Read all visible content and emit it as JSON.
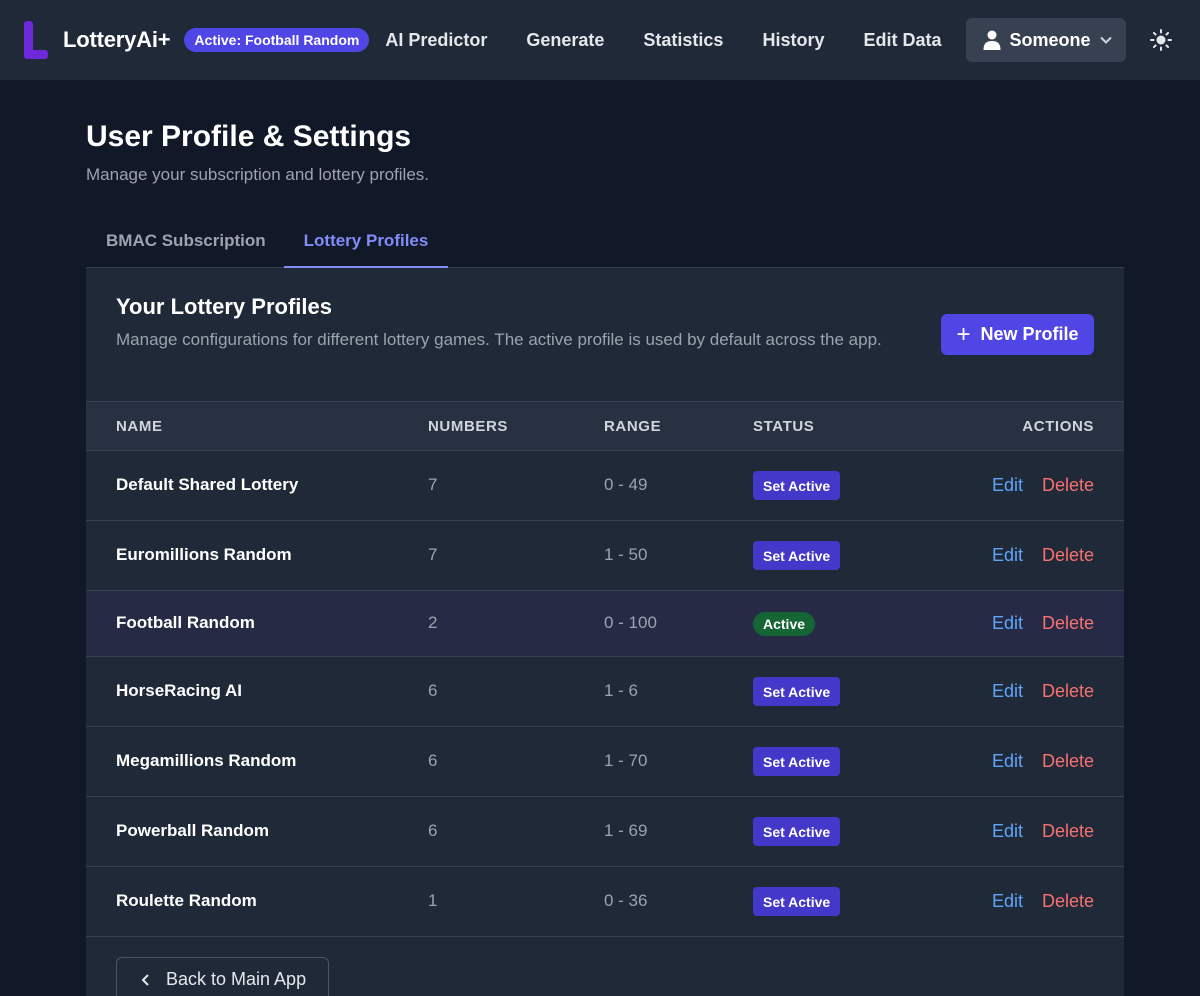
{
  "nav": {
    "brand": "LotteryAi+",
    "active_badge": "Active: Football Random",
    "links": [
      "AI Predictor",
      "Generate",
      "Statistics",
      "History",
      "Edit Data"
    ],
    "user_label": "Someone"
  },
  "header": {
    "title": "User Profile & Settings",
    "subtitle": "Manage your subscription and lottery profiles."
  },
  "tabs": [
    "BMAC Subscription",
    "Lottery Profiles"
  ],
  "selected_tab": "Lottery Profiles",
  "card": {
    "title": "Your Lottery Profiles",
    "description": "Manage configurations for different lottery games. The active profile is used by default across the app.",
    "new_button": "New Profile"
  },
  "table": {
    "headers": [
      "NAME",
      "NUMBERS",
      "RANGE",
      "STATUS",
      "ACTIONS"
    ],
    "rows": [
      {
        "name": "Default Shared Lottery",
        "numbers": "7",
        "range": "0 - 49",
        "status": "Set Active",
        "edit": "Edit",
        "delete": "Delete"
      },
      {
        "name": "Euromillions Random",
        "numbers": "7",
        "range": "1 - 50",
        "status": "Set Active",
        "edit": "Edit",
        "delete": "Delete"
      },
      {
        "name": "Football Random",
        "numbers": "2",
        "range": "0 - 100",
        "status": "Active",
        "edit": "Edit",
        "delete": "Delete"
      },
      {
        "name": "HorseRacing AI",
        "numbers": "6",
        "range": "1 - 6",
        "status": "Set Active",
        "edit": "Edit",
        "delete": "Delete"
      },
      {
        "name": "Megamillions Random",
        "numbers": "6",
        "range": "1 - 70",
        "status": "Set Active",
        "edit": "Edit",
        "delete": "Delete"
      },
      {
        "name": "Powerball Random",
        "numbers": "6",
        "range": "1 - 69",
        "status": "Set Active",
        "edit": "Edit",
        "delete": "Delete"
      },
      {
        "name": "Roulette Random",
        "numbers": "1",
        "range": "0 - 36",
        "status": "Set Active",
        "edit": "Edit",
        "delete": "Delete"
      }
    ]
  },
  "back_button": "Back to Main App",
  "colors": {
    "background": "#111827",
    "surface": "#1f2937",
    "accent": "#4f46e5",
    "tab_active": "#818cf8",
    "active_status": "#166534",
    "edit_link": "#60a5fa",
    "delete_link": "#f87171"
  },
  "icons": {
    "logo": "logo-mark",
    "user": "user-icon",
    "dropdown": "chevron-down-icon",
    "theme": "sun-icon",
    "new": "plus-icon",
    "back": "chevron-left-icon"
  }
}
